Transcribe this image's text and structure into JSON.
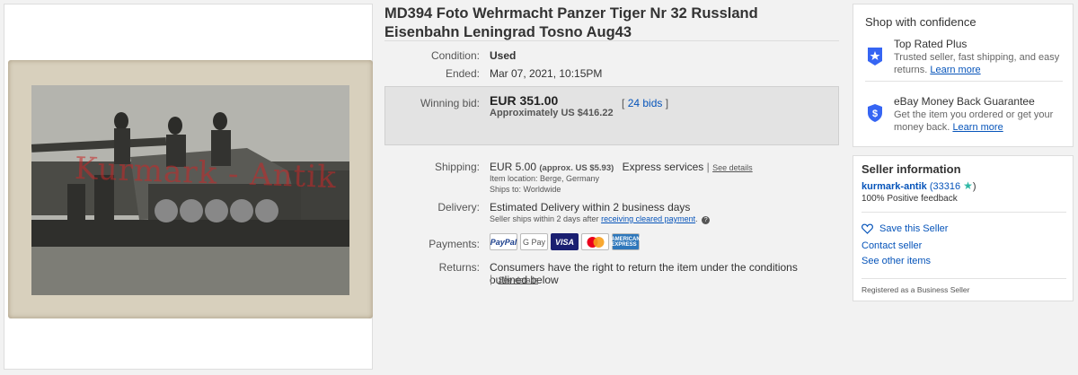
{
  "listing": {
    "title": "MD394 Foto Wehrmacht Panzer Tiger Nr 32 Russland Eisenbahn Leningrad Tosno Aug43",
    "watermark": "Kurmark - Antik"
  },
  "details": {
    "condition_label": "Condition:",
    "condition_value": "Used",
    "ended_label": "Ended:",
    "ended_value": "Mar 07, 2021, 10:15PM",
    "winning_bid_label": "Winning bid:",
    "price": "EUR 351.00",
    "approx": "Approximately US $416.22",
    "bids": "24 bids",
    "bids_open": "[",
    "bids_close": "]"
  },
  "shipping": {
    "label": "Shipping:",
    "cost": "EUR 5.00",
    "approx": "(approx. US $5.93)",
    "service": "Express services",
    "sep": "|",
    "details_link": "See details",
    "location": "Item location:  Berge, Germany",
    "ships_to": "Ships to:  Worldwide"
  },
  "delivery": {
    "label": "Delivery:",
    "value": "Estimated Delivery within 2 business days",
    "note_prefix": "Seller ships within 2 days after",
    "note_link": "receiving cleared payment",
    "note_suffix": ".",
    "info_icon": "info-icon"
  },
  "payments": {
    "label": "Payments:",
    "methods": [
      "PayPal",
      "G Pay",
      "VISA",
      "",
      "AMERICAN EXPRESS"
    ]
  },
  "returns": {
    "label": "Returns:",
    "value": "Consumers have the right to return the item under the conditions outlined below",
    "sep": "|",
    "details_link": "See details"
  },
  "confidence": {
    "title": "Shop with confidence",
    "top_rated_title": "Top Rated Plus",
    "top_rated_text": "Trusted seller, fast shipping, and easy returns.",
    "top_rated_link": "Learn more",
    "mbg_title": "eBay Money Back Guarantee",
    "mbg_text": "Get the item you ordered or get your money back.",
    "mbg_link": "Learn more"
  },
  "seller": {
    "title": "Seller information",
    "name": "kurmark-antik",
    "score": "(33316",
    "score_close": ")",
    "feedback": "100% Positive feedback",
    "save": "Save this Seller",
    "contact": "Contact seller",
    "other": "See other items",
    "registered": "Registered as a Business Seller"
  },
  "colors": {
    "link": "#0654ba",
    "panel_bg": "#e3e3e3",
    "page_bg": "#f2f2f2"
  }
}
